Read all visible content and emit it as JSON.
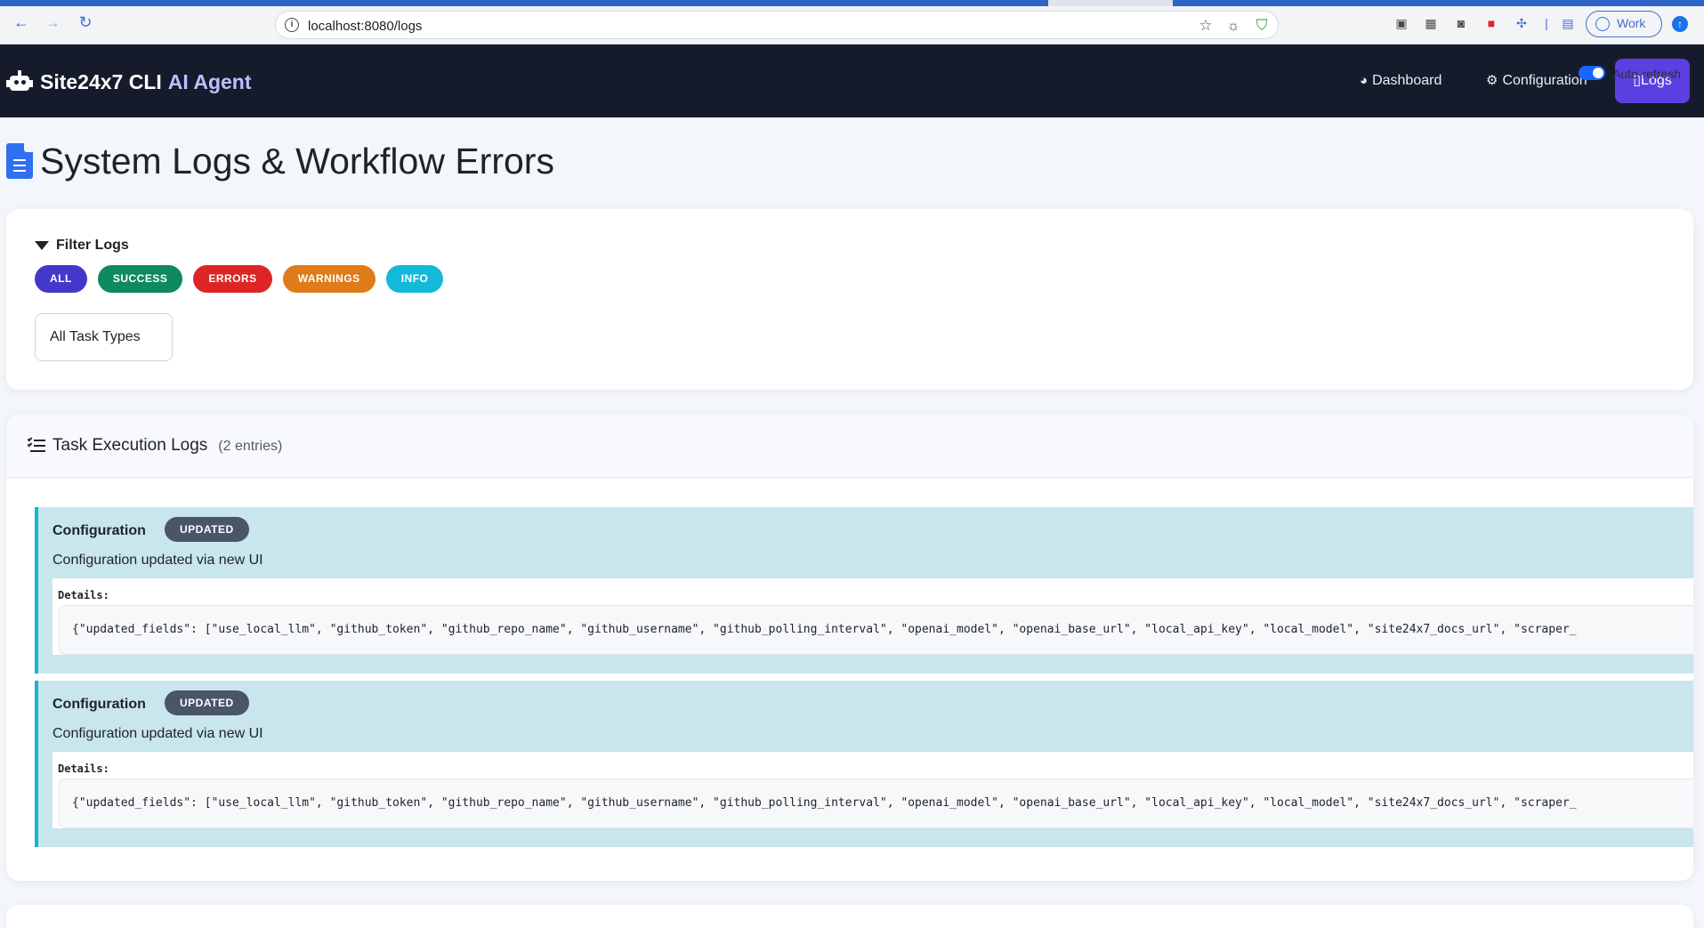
{
  "browser": {
    "url": "localhost:8080/logs",
    "profile_label": "Work"
  },
  "navbar": {
    "brand_part1": "Site24x7 CLI",
    "brand_part2": "AI Agent",
    "links": {
      "dashboard": "Dashboard",
      "configuration": "Configuration",
      "logs": "Logs"
    },
    "auto_refresh_label": "Auto-refresh",
    "auto_refresh_on": true
  },
  "page": {
    "title": "System Logs & Workflow Errors"
  },
  "filter": {
    "title": "Filter Logs",
    "pills": {
      "all": "ALL",
      "success": "SUCCESS",
      "errors": "ERRORS",
      "warnings": "WARNINGS",
      "info": "INFO"
    },
    "task_type_select": "All Task Types"
  },
  "logs": {
    "title": "Task Execution Logs",
    "count_text": "(2 entries)",
    "entries": [
      {
        "title": "Configuration",
        "badge": "UPDATED",
        "message": "Configuration updated via new UI",
        "details_label": "Details:",
        "details": "{\"updated_fields\": [\"use_local_llm\", \"github_token\", \"github_repo_name\", \"github_username\", \"github_polling_interval\", \"openai_model\", \"openai_base_url\", \"local_api_key\", \"local_model\", \"site24x7_docs_url\", \"scraper_"
      },
      {
        "title": "Configuration",
        "badge": "UPDATED",
        "message": "Configuration updated via new UI",
        "details_label": "Details:",
        "details": "{\"updated_fields\": [\"use_local_llm\", \"github_token\", \"github_repo_name\", \"github_username\", \"github_polling_interval\", \"openai_model\", \"openai_base_url\", \"local_api_key\", \"local_model\", \"site24x7_docs_url\", \"scraper_"
      }
    ]
  },
  "colors": {
    "navbar_bg": "#151b2b",
    "active_nav": "#5b3fe0",
    "pill_all": "#4338ca",
    "pill_success": "#0f8a5f",
    "pill_errors": "#dc2626",
    "pill_warnings": "#e07b1a",
    "pill_info": "#14b8d8",
    "entry_bg": "#c8e6ec",
    "entry_border": "#12b5d6",
    "badge_bg": "#4a5568"
  }
}
